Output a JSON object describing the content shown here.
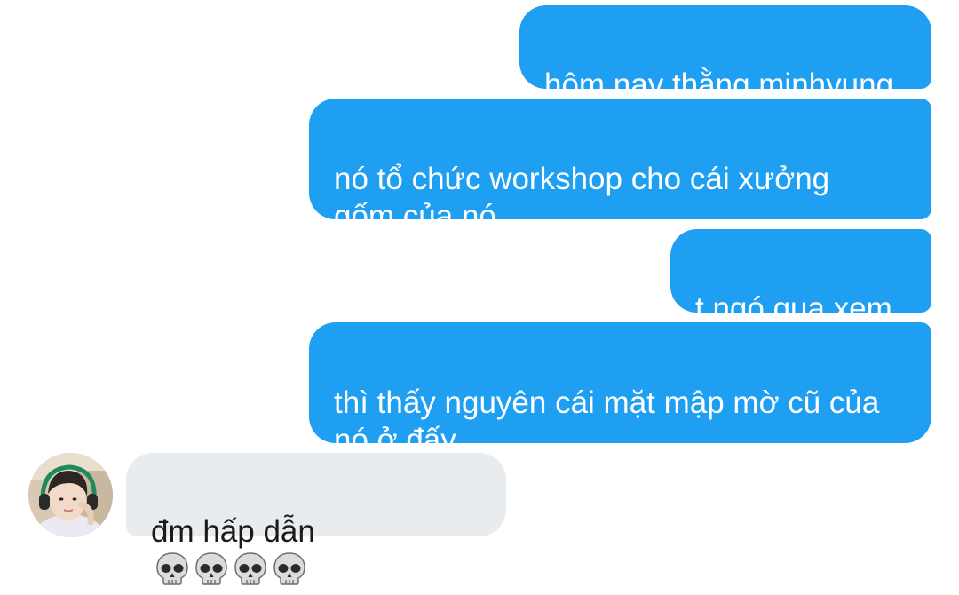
{
  "conversation": {
    "messages": [
      {
        "direction": "outgoing",
        "text": "hôm nay thằng minhyung"
      },
      {
        "direction": "outgoing",
        "text": "nó tổ chức workshop cho cái xưởng\ngốm của nó"
      },
      {
        "direction": "outgoing",
        "text": "t ngó qua xem"
      },
      {
        "direction": "outgoing",
        "text": "thì thấy nguyên cái mặt mập mờ cũ của\nnó ở đấy"
      },
      {
        "direction": "incoming",
        "text": "đm hấp dẫn",
        "emoji": [
          "skull",
          "skull",
          "skull",
          "skull"
        ]
      }
    ]
  },
  "colors": {
    "outgoing_bubble": "#1e9ff2",
    "incoming_bubble": "#e9ecef",
    "outgoing_text": "#ffffff",
    "incoming_text": "#1a1a1a"
  }
}
